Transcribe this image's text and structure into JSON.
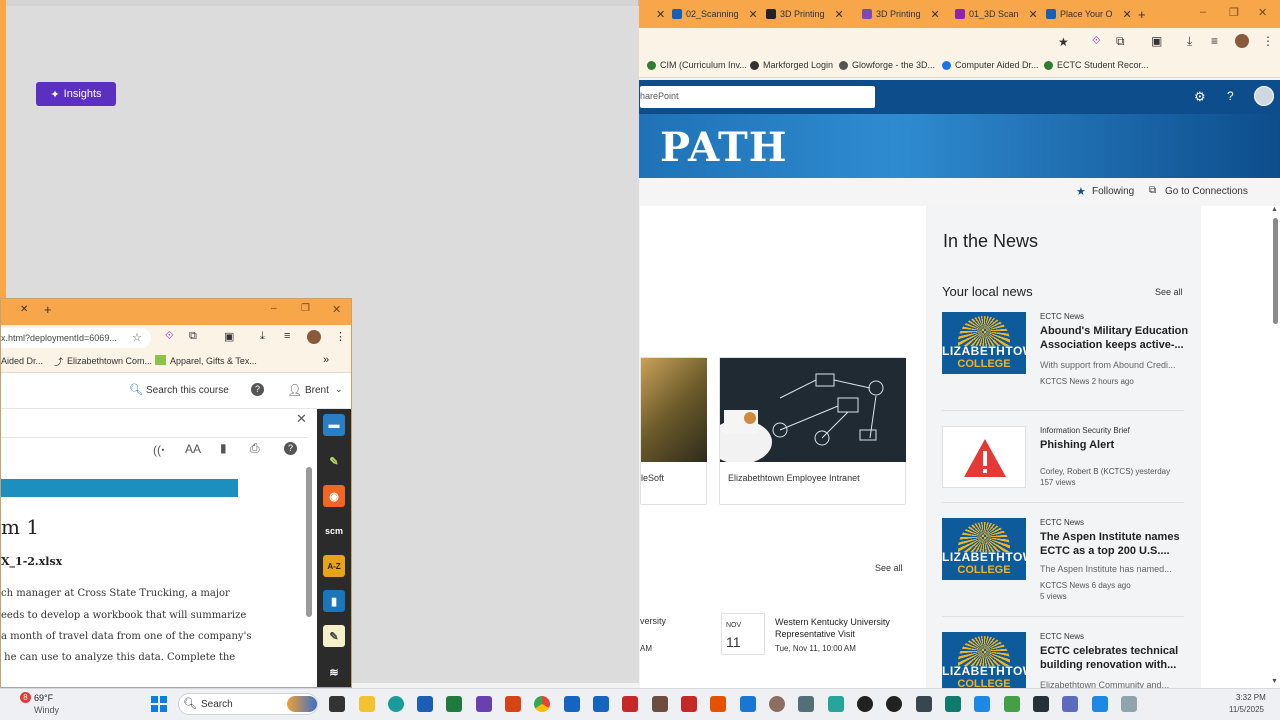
{
  "back_browser": {
    "tabs": [
      {
        "label": "02_Scanning",
        "color": "#1a5fb4"
      },
      {
        "label": "3D Printing",
        "color": "#222222"
      },
      {
        "label": "3D Printing",
        "color": "#7b4bb3"
      },
      {
        "label": "01_3D Scan",
        "color": "#8e24aa"
      },
      {
        "label": "Place Your O",
        "color": "#1a5fb4"
      }
    ],
    "new_tab": "+",
    "window_controls": [
      "–",
      "❐",
      "✕"
    ],
    "bookmarks": [
      {
        "label": "CIM (Curriculum Inv...",
        "color": "#2e7d32"
      },
      {
        "label": "Markforged Login",
        "color": "#333333"
      },
      {
        "label": "Glowforge - the 3D...",
        "color": "#555555"
      },
      {
        "label": "Computer Aided Dr...",
        "color": "#1a73e8"
      },
      {
        "label": "ECTC Student Recor...",
        "color": "#2e7d32"
      }
    ]
  },
  "sharepoint": {
    "search_placeholder": "harePoint",
    "hero_title": "PATH",
    "following": "Following",
    "go_to_connections": "Go to Connections",
    "apps": [
      {
        "label": "leSoft"
      },
      {
        "label": "Elizabethtown Employee Intranet"
      }
    ],
    "events_see_all": "See all",
    "events": [
      {
        "title_fragment": "versity",
        "time_fragment": "AM"
      },
      {
        "month": "NOV",
        "day": "11",
        "title": "Western Kentucky University Representative Visit",
        "time": "Tue, Nov 11, 10:00 AM"
      }
    ],
    "in_the_news": "In the News",
    "your_local_news": "Your local news",
    "news_see_all": "See all",
    "news": [
      {
        "source": "ECTC News",
        "title": "Abound's Military Education Association keeps active-...",
        "desc": "With support from Abound Credi...",
        "meta": "KCTCS News  2 hours ago",
        "views": "",
        "thumb": "college"
      },
      {
        "source": "Information Security Brief",
        "title": "Phishing Alert",
        "desc": "",
        "meta": "Corley, Robert B (KCTCS)  yesterday",
        "views": "157 views",
        "thumb": "alert"
      },
      {
        "source": "ECTC News",
        "title": "The Aspen Institute names ECTC as a top 200 U.S....",
        "desc": "The Aspen Institute has named...",
        "meta": "KCTCS News  6 days ago",
        "views": "5 views",
        "thumb": "college"
      },
      {
        "source": "ECTC News",
        "title": "ECTC celebrates technical building renovation with...",
        "desc": "Elizabethtown Community and...",
        "meta": "",
        "views": "",
        "thumb": "college"
      }
    ],
    "thumb_text_1": "LIZABETHTOWN",
    "thumb_text_2": "COLLEGE"
  },
  "front_browser": {
    "url": "x.html?deploymentId=6069...",
    "bookmarks": [
      "Aided Dr...",
      "Elizabethtown Com...",
      "Apparel, Gifts & Tex..."
    ],
    "insights": "Insights",
    "search_course": "Search this course",
    "user": "Brent",
    "reader": {
      "heading": "m 1",
      "file": "X_1-2.xlsx",
      "body_lines": [
        "ch manager at Cross State Trucking, a major",
        "eeds to develop a workbook that will summarize",
        "a month of travel data from one of the company's",
        " he can use to analyze this data. Complete the"
      ]
    },
    "tools": [
      {
        "icon": "briefcase-icon",
        "color": "#2a7fc4",
        "glyph": "▬"
      },
      {
        "icon": "highlighter-icon",
        "color": "#2b2b2b",
        "glyph": "✎"
      },
      {
        "icon": "rss-icon",
        "color": "#f26522",
        "glyph": "◉"
      },
      {
        "icon": "scm-icon",
        "color": "#2b2b2b",
        "glyph": "scm"
      },
      {
        "icon": "az-icon",
        "color": "#e8a317",
        "glyph": "A-Z"
      },
      {
        "icon": "book-icon",
        "color": "#1b75bb",
        "glyph": "▮"
      },
      {
        "icon": "notepad-icon",
        "color": "#f5f0c8",
        "glyph": "✎"
      },
      {
        "icon": "speech-icon",
        "color": "#2b2b2b",
        "glyph": "≋"
      }
    ]
  },
  "taskbar": {
    "weather_temp": "69°F",
    "weather_desc": "Windy",
    "weather_badge": "8",
    "search": "Search",
    "time": "3:32 PM",
    "date": "11/5/2025"
  }
}
